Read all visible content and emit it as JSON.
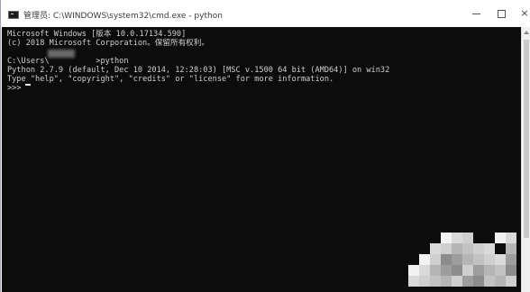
{
  "window": {
    "title": "管理员: C:\\WINDOWS\\system32\\cmd.exe - python",
    "controls": {
      "minimize_icon": "minimize-icon",
      "maximize_icon": "maximize-icon",
      "close_icon": "close-icon",
      "close_label": "×"
    }
  },
  "console": {
    "lines": [
      "Microsoft Windows [版本 10.0.17134.590]",
      "(c) 2018 Microsoft Corporation。保留所有权利。",
      "",
      "C:\\Users\\          >python",
      "Python 2.7.9 (default, Dec 10 2014, 12:28:03) [MSC v.1500 64 bit (AMD64)] on win32",
      "Type \"help\", \"copyright\", \"credits\" or \"license\" for more information.",
      ">>> "
    ]
  },
  "colors": {
    "console_bg": "#0c0c0c",
    "console_fg": "#cfcfcf",
    "titlebar_bg": "#ffffff"
  }
}
